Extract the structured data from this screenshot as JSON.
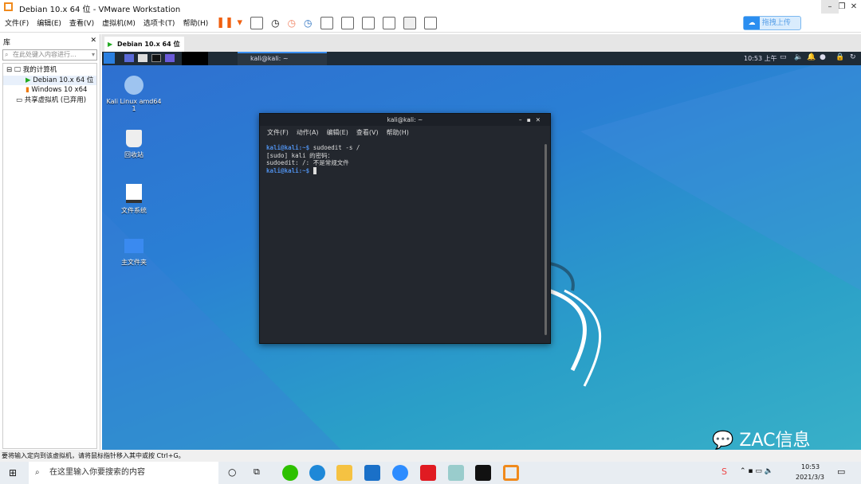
{
  "window": {
    "title": "Debian 10.x 64 位 - VMware Workstation"
  },
  "menu": [
    "文件(F)",
    "编辑(E)",
    "查看(V)",
    "虚拟机(M)",
    "选项卡(T)",
    "帮助(H)"
  ],
  "upload_label": "拖拽上传",
  "library": {
    "title": "库",
    "search_placeholder": "在此处键入内容进行...",
    "tree": [
      "我的计算机",
      "Debian 10.x 64 位",
      "Windows 10 x64",
      "共享虚拟机 (已弃用)"
    ]
  },
  "tab": {
    "label": "Debian 10.x 64 位"
  },
  "kali": {
    "task": "kali@kali: ~",
    "clock": "10:53 上午"
  },
  "desktop": [
    {
      "label": "Kali Linux amd64 1"
    },
    {
      "label": "回收站"
    },
    {
      "label": "文件系统"
    },
    {
      "label": "主文件夹"
    }
  ],
  "terminal": {
    "title": "kali@kali: ~",
    "menu": [
      "文件(F)",
      "动作(A)",
      "编辑(E)",
      "查看(V)",
      "帮助(H)"
    ],
    "prompt": "kali@kali",
    "path": ":~$",
    "cmd": " sudoedit -s /",
    "line2": "[sudo] kali 的密码：",
    "line3": "sudoedit: /: 不是常规文件"
  },
  "watermark": "ZAC信息",
  "status": "要将输入定向到该虚拟机，请将鼠标指针移入其中或按 Ctrl+G。",
  "taskbar": {
    "search": "在这里输入你要搜索的内容",
    "time": "10:53",
    "date": "2021/3/3"
  }
}
